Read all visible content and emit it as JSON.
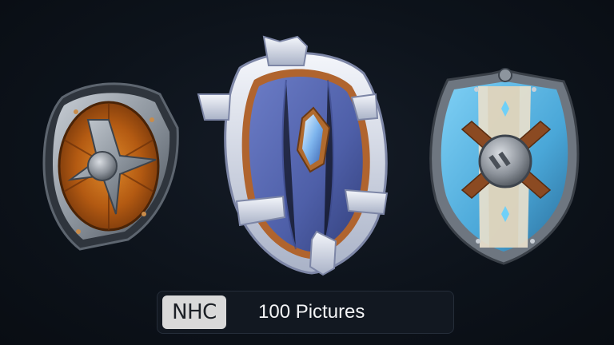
{
  "scene": {
    "background_color": "#0c1119",
    "shields": [
      {
        "name": "round-wooden-shield",
        "colors": {
          "wood": "#b35a12",
          "metal": "#8d959e",
          "rim": "#3d444d"
        }
      },
      {
        "name": "crystal-kite-shield",
        "colors": {
          "face": "#4e5fa8",
          "gem": "#9fd4ff",
          "metal": "#dfe5f1"
        }
      },
      {
        "name": "blue-heater-shield",
        "colors": {
          "face": "#4aa7d8",
          "band": "#e8e0cc",
          "boss": "#8a9098"
        }
      }
    ]
  },
  "badge": {
    "logo_text": "NHC",
    "caption": "100 Pictures"
  }
}
